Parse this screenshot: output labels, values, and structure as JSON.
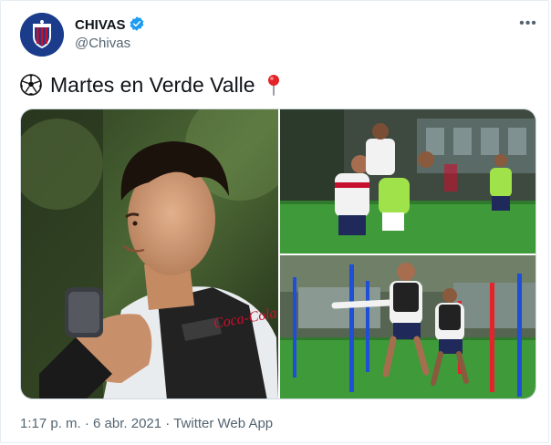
{
  "author": {
    "display_name": "CHIVAS",
    "handle": "@Chivas"
  },
  "tweet": {
    "text": "Martes en Verde Valle",
    "emoji_leading": "soccer-ball",
    "emoji_trailing": "round-pushpin"
  },
  "media": {
    "photos": [
      {
        "label": "player-closeup-with-weights"
      },
      {
        "label": "players-training-drill"
      },
      {
        "label": "players-running-between-poles"
      }
    ],
    "sponsor_text": "Coca-Cola"
  },
  "meta": {
    "time": "1:17 p. m.",
    "separator": "·",
    "date": "6 abr. 2021",
    "source": "Twitter Web App"
  },
  "colors": {
    "accent_blue": "#1d9bf0",
    "text_primary": "#0f1419",
    "text_secondary": "#536471",
    "grass_green": "#3f9a3a",
    "chivas_red": "#c8102e",
    "chivas_blue": "#1a3c8b"
  }
}
